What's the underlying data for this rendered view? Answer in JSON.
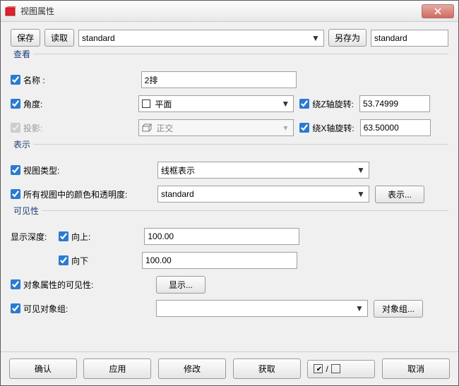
{
  "window": {
    "title": "视图属性"
  },
  "top": {
    "save_label": "保存",
    "load_label": "读取",
    "preset_value": "standard",
    "saveas_label": "另存为",
    "saveas_value": "standard"
  },
  "view": {
    "group_title": "查看",
    "name_label": "名称 :",
    "name_value": "2排",
    "angle_label": "角度:",
    "angle_option": "平面",
    "rotz_label": "绕Z轴旋转:",
    "rotz_value": "53.74999",
    "proj_label": "投影:",
    "proj_option": "正交",
    "rotx_label": "绕X轴旋转:",
    "rotx_value": "63.50000"
  },
  "display": {
    "group_title": "表示",
    "viewtype_label": "视图类型:",
    "viewtype_value": "线框表示",
    "colors_label": "所有视图中的颜色和透明度:",
    "colors_value": "standard",
    "display_btn": "表示..."
  },
  "visibility": {
    "group_title": "可见性",
    "depth_label": "显示深度:",
    "up_label": "向上:",
    "up_value": "100.00",
    "down_label": "向下",
    "down_value": "100.00",
    "objvis_label": "对象属性的可见性:",
    "objvis_btn": "显示...",
    "objgroup_label": "可见对象组:",
    "objgroup_value": "",
    "objgroup_btn": "对象组..."
  },
  "bottom": {
    "ok": "确认",
    "apply": "应用",
    "modify": "修改",
    "get": "获取",
    "cancel": "取消"
  }
}
